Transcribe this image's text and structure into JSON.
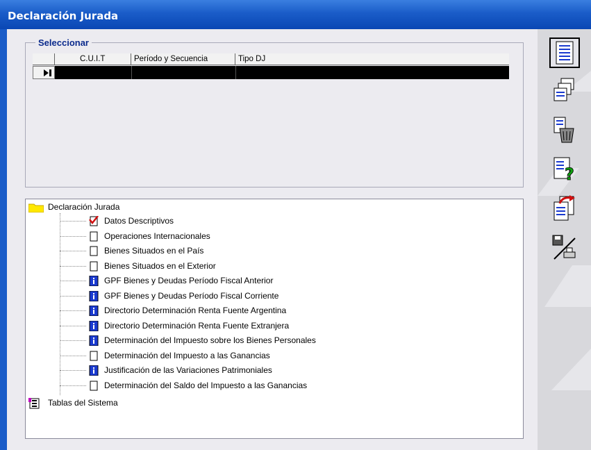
{
  "window": {
    "title": "Declaración Jurada"
  },
  "select_panel": {
    "legend": "Seleccionar",
    "columns": [
      "C.U.I.T",
      "Período y Secuencia",
      "Tipo DJ"
    ]
  },
  "tree": {
    "root": "Declaración Jurada",
    "items": [
      {
        "label": "Datos Descriptivos",
        "icon": "checked-document-icon"
      },
      {
        "label": "Operaciones Internacionales",
        "icon": "blank-document-icon"
      },
      {
        "label": "Bienes Situados en el País",
        "icon": "blank-document-icon"
      },
      {
        "label": "Bienes Situados en el Exterior",
        "icon": "blank-document-icon"
      },
      {
        "label": "GPF Bienes y Deudas Período Fiscal Anterior",
        "icon": "info-book-icon"
      },
      {
        "label": "GPF Bienes y Deudas Período Fiscal Corriente",
        "icon": "info-book-icon"
      },
      {
        "label": "Directorio Determinación Renta Fuente Argentina",
        "icon": "info-book-icon"
      },
      {
        "label": "Directorio Determinación Renta Fuente Extranjera",
        "icon": "info-book-icon"
      },
      {
        "label": "Determinación del Impuesto sobre los Bienes Personales",
        "icon": "info-book-icon"
      },
      {
        "label": "Determinación del Impuesto a las Ganancias",
        "icon": "blank-document-icon"
      },
      {
        "label": "Justificación de las Variaciones Patrimoniales",
        "icon": "info-book-icon"
      },
      {
        "label": "Determinación del Saldo del Impuesto a las Ganancias",
        "icon": "blank-document-icon"
      }
    ],
    "root2": "Tablas del Sistema"
  },
  "toolbar": {
    "buttons": [
      "list-document-icon",
      "copy-documents-icon",
      "delete-document-icon",
      "help-document-icon",
      "export-document-icon",
      "save-print-icon"
    ]
  }
}
